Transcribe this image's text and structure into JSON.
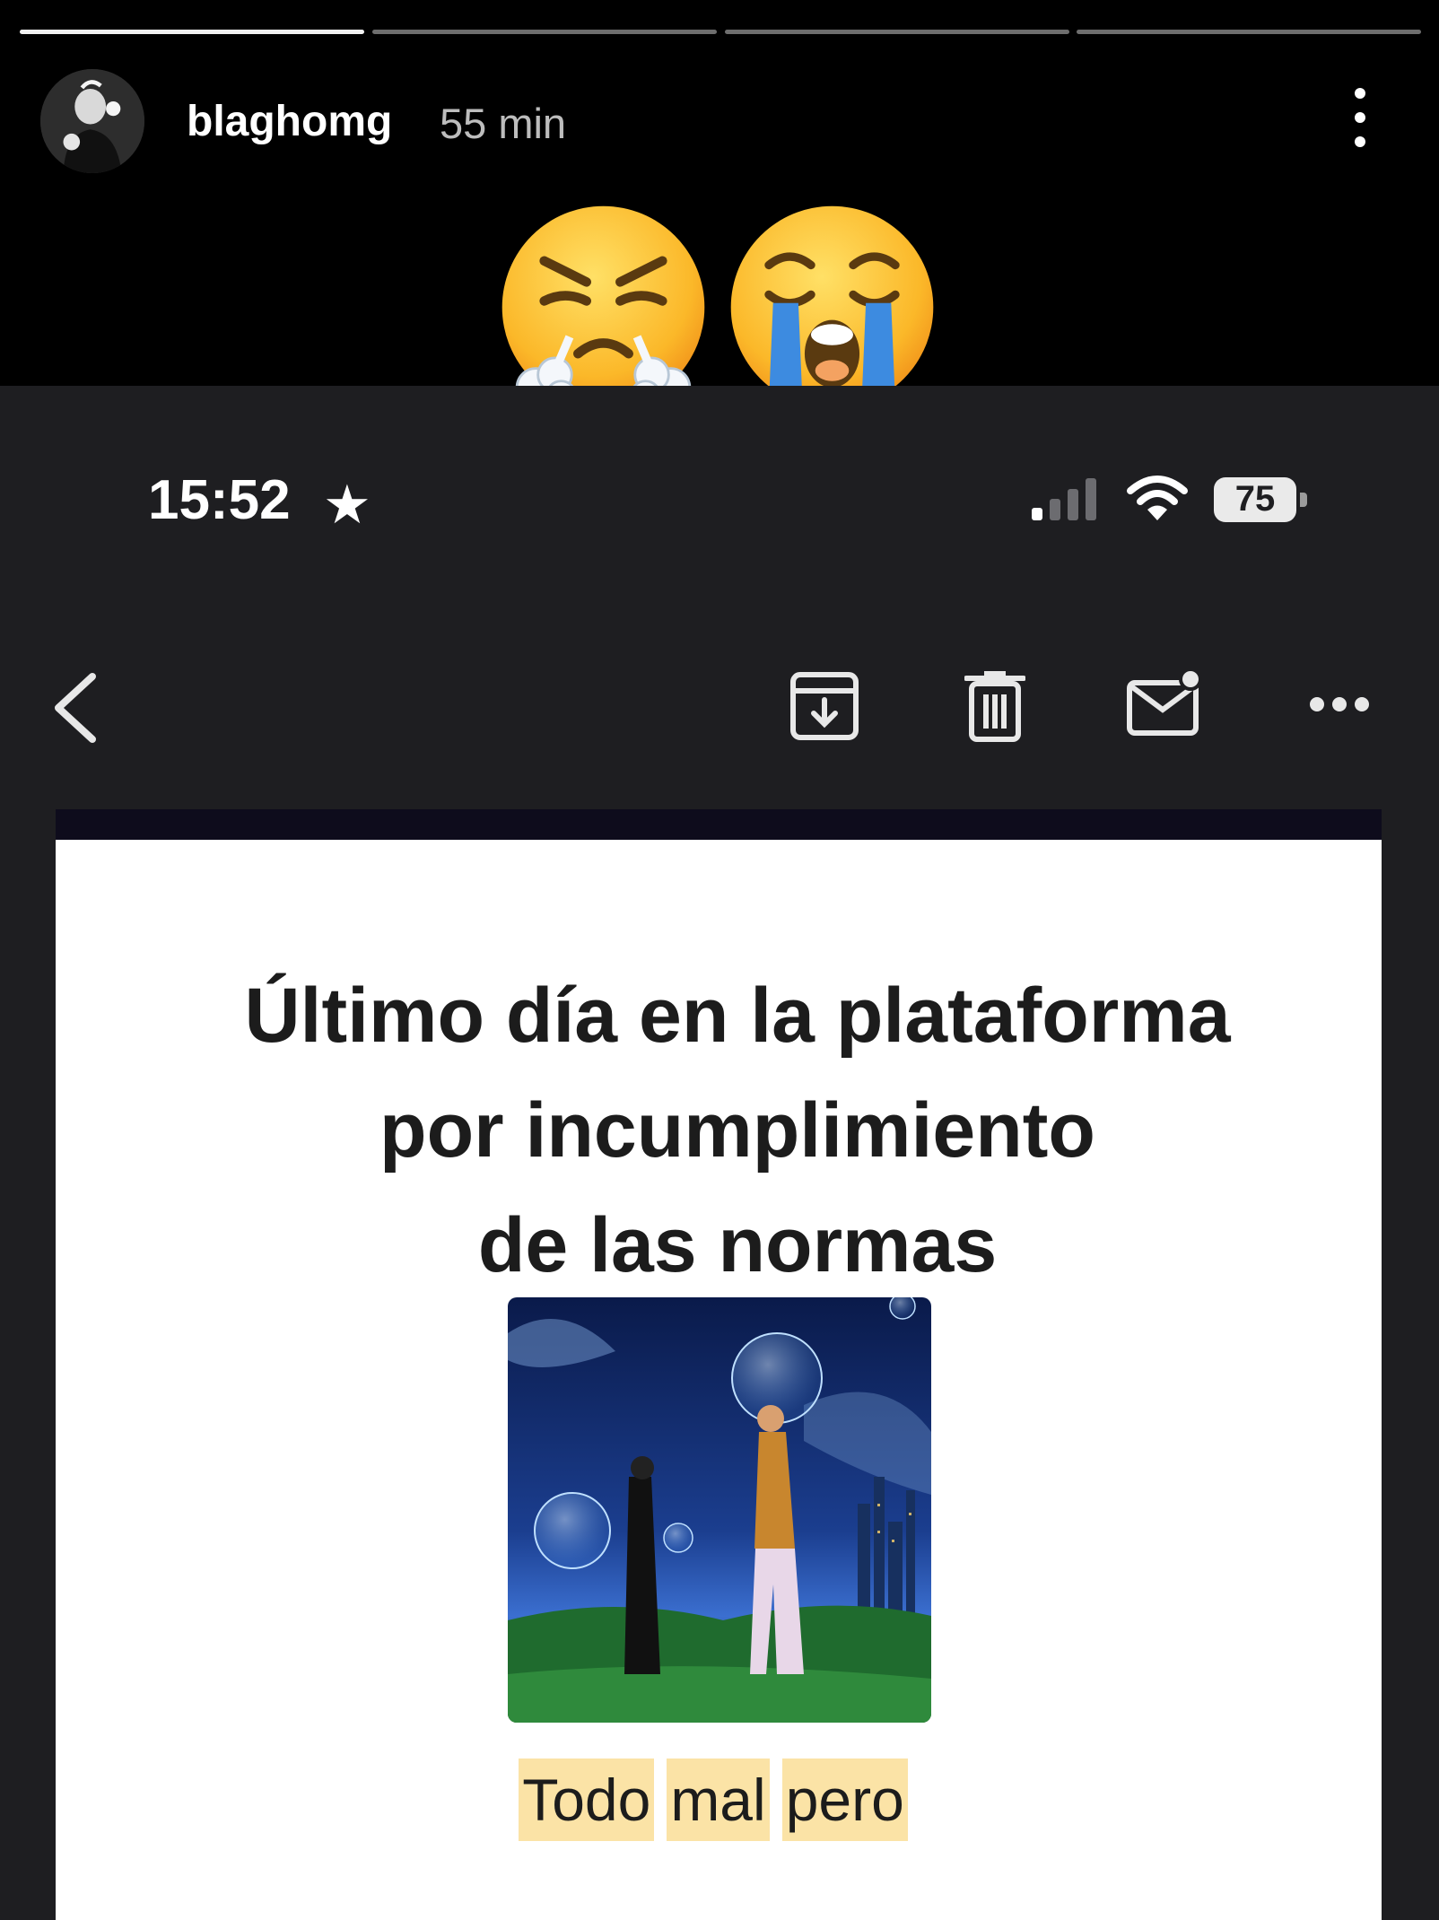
{
  "story": {
    "progress": [
      1.0,
      0.0,
      0.0,
      0.0
    ],
    "username": "blaghomg",
    "time_ago": "55 min",
    "reactions": [
      "steam-from-nose-emoji",
      "loudly-crying-emoji"
    ]
  },
  "status_bar": {
    "time": "15:52",
    "star_icon": "★",
    "battery": "75"
  },
  "toolbar": {
    "icons": [
      "back-chevron-icon",
      "archive-icon",
      "trash-icon",
      "mark-unread-icon",
      "more-icon"
    ]
  },
  "email": {
    "headline_lines": [
      "Último día en la plataforma",
      "por incumplimiento",
      "de las normas"
    ],
    "caption_words": [
      "Todo",
      "mal",
      "pero"
    ]
  }
}
